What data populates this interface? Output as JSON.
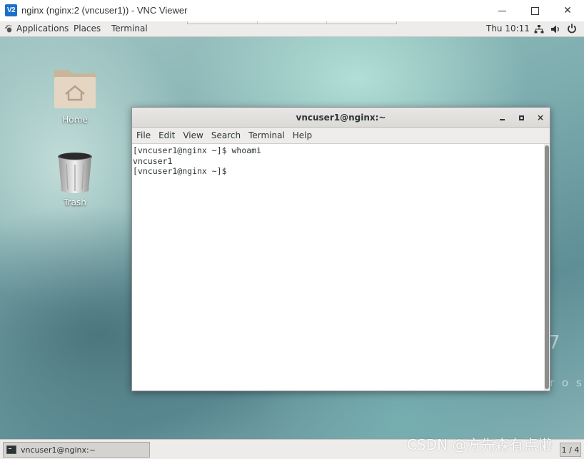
{
  "vnc_window": {
    "logo_text": "V2",
    "title": "nginx (nginx:2 (vncuser1)) - VNC Viewer",
    "minimize_label": "",
    "maximize_label": "",
    "close_label": "✕"
  },
  "topbar": {
    "applications_label": "Applications",
    "places_label": "Places",
    "terminal_label": "Terminal",
    "clock": "Thu 10:11"
  },
  "desktop_icons": {
    "home_label": "Home",
    "trash_label": "Trash"
  },
  "background": {
    "version_digit": "7",
    "brand_fragment": "r o s"
  },
  "terminal": {
    "title": "vncuser1@nginx:~",
    "close_label": "×",
    "menu": [
      "File",
      "Edit",
      "View",
      "Search",
      "Terminal",
      "Help"
    ],
    "lines": [
      "[vncuser1@nginx ~]$ whoami",
      "vncuser1",
      "[vncuser1@nginx ~]$ "
    ]
  },
  "taskbar": {
    "window_item_label": "vncuser1@nginx:~",
    "workspace_label": "1 / 4"
  },
  "watermark": "CSDN @方先森有点懒",
  "colors": {
    "vnc_logo": "#1a6fc9",
    "gnome_bar": "#edeceb",
    "terminal_text": "#2e3436"
  },
  "icons": {
    "apps": "gnome-foot-icon",
    "network": "network-wired-icon",
    "volume": "volume-icon",
    "power": "power-icon"
  }
}
